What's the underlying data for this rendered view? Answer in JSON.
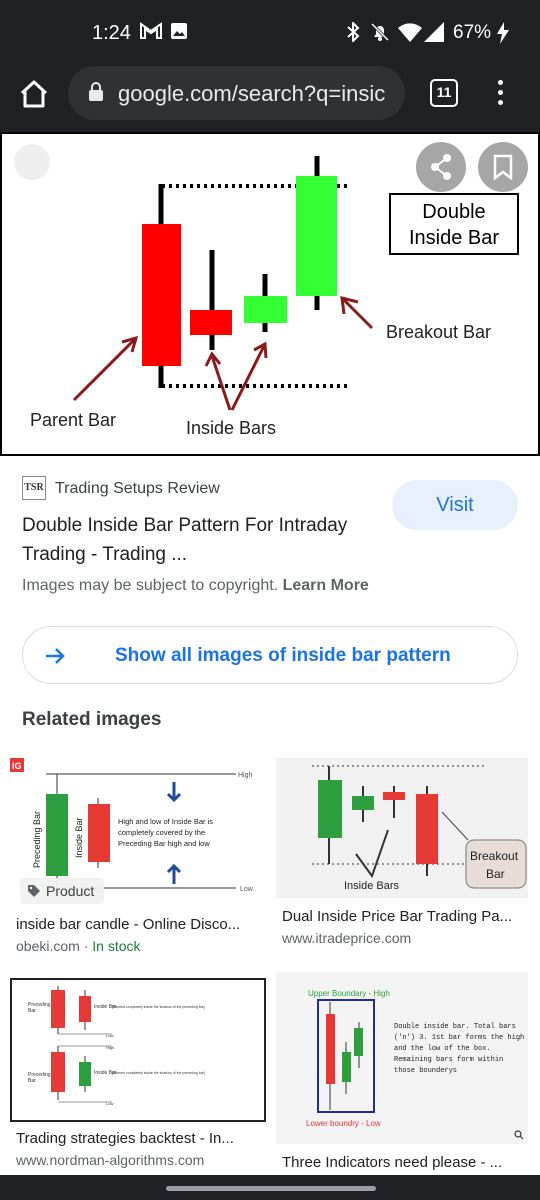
{
  "status_bar": {
    "time": "1:24",
    "battery": "67%"
  },
  "browser": {
    "url": "google.com/search?q=insic",
    "tab_count": "11"
  },
  "main_image": {
    "callout": "Double\nInside Bar",
    "callout_line1": "Double",
    "callout_line2": "Inside Bar",
    "parent_label": "Parent Bar",
    "inside_label": "Inside Bars",
    "breakout_label": "Breakout Bar",
    "colors": {
      "red": "#ff0000",
      "green": "#33ff33"
    }
  },
  "source": {
    "logo_text": "TSR",
    "site_name": "Trading Setups Review",
    "visit_label": "Visit",
    "title": "Double Inside Bar Pattern For Intraday Trading - Trading ...",
    "copyright_prefix": "Images may be subject to copyright.",
    "learn_more": "Learn More"
  },
  "show_all": {
    "label": "Show all images of inside bar pattern"
  },
  "related": {
    "heading": "Related images",
    "items": [
      {
        "title": "inside bar candle - Online Disco...",
        "site": "obeki.com",
        "stock": "In stock",
        "badge": "Product",
        "thumb_text": {
          "logo": "IG",
          "preceding": "Preceding Bar",
          "inside": "Inside Bar",
          "desc": "High and low of Inside Bar is completely covered by the Preceding Bar high and low",
          "high": "High",
          "low": "Low"
        }
      },
      {
        "title": "Dual Inside Price Bar Trading Pa...",
        "site": "www.itradeprice.com",
        "thumb_text": {
          "inside": "Inside Bars",
          "breakout1": "Breakout",
          "breakout2": "Bar"
        }
      },
      {
        "title": "Trading strategies backtest - In...",
        "site": "www.nordman-algorithms.com",
        "thumb_text": {
          "preceding": "Preceding Bar",
          "inside": "Inside Bar",
          "note": "[Formed completely inside the shadow of the preceding bar]",
          "low": "Low",
          "high": "High"
        }
      },
      {
        "title": "Three Indicators need please - ...",
        "thumb_text": {
          "upper": "Upper Boundary - High",
          "lower": "Lower boundry - Low",
          "desc1": "Double inside bar. Total bars",
          "desc2": "('n') 3. 1st bar forms the high",
          "desc3": "and the low of the box.",
          "desc4": "Remaining bars form within",
          "desc5": "those bounderys"
        }
      }
    ]
  }
}
